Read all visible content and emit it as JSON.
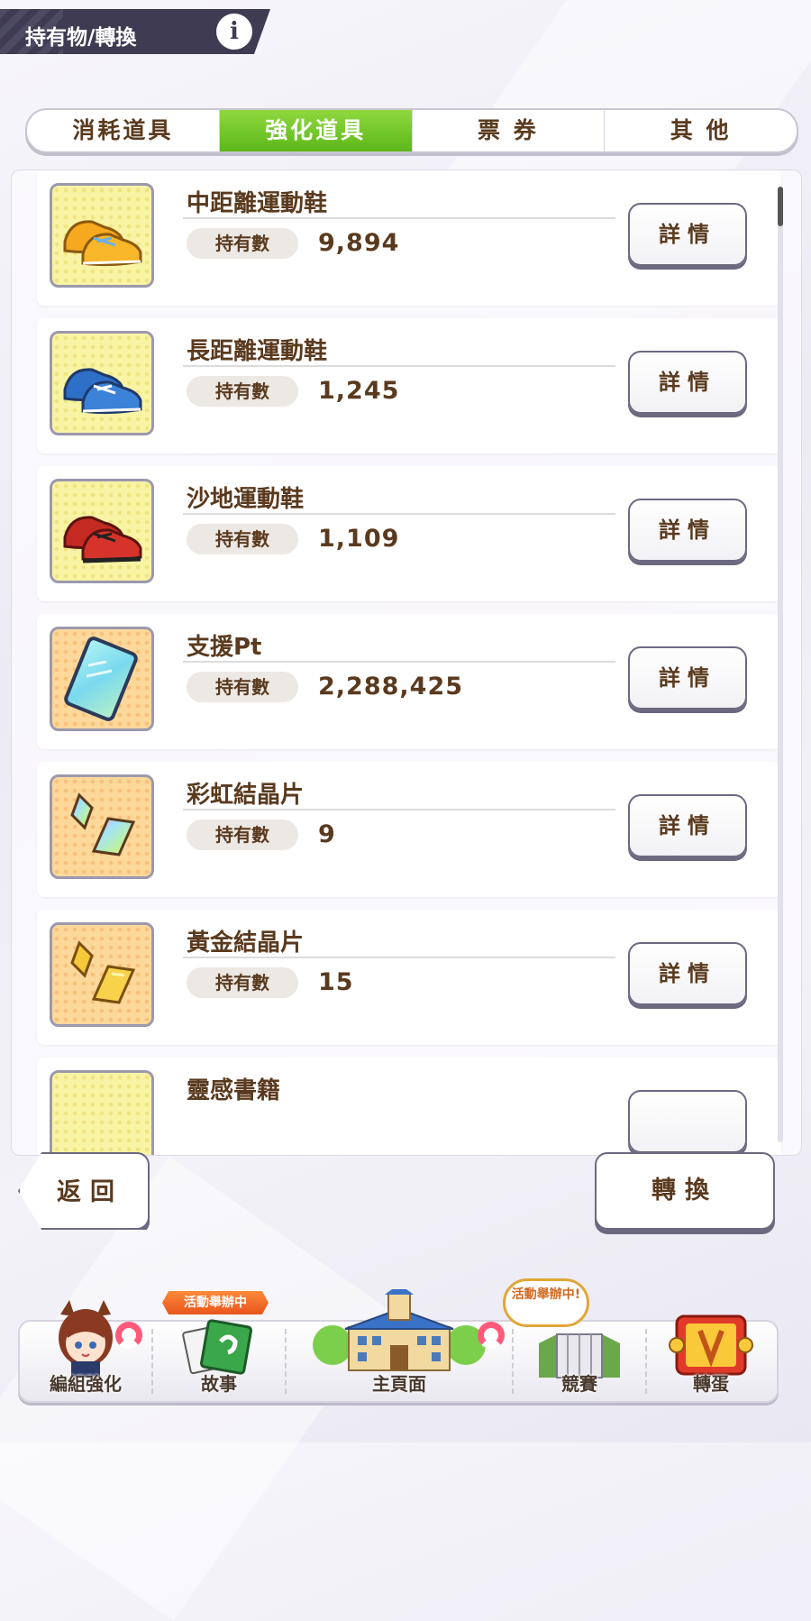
{
  "header": {
    "title": "持有物/轉換",
    "info_icon": "i"
  },
  "tabs": [
    {
      "label": "消耗道具",
      "active": false
    },
    {
      "label": "強化道具",
      "active": true
    },
    {
      "label": "票 券",
      "active": false
    },
    {
      "label": "其 他",
      "active": false
    }
  ],
  "items": [
    {
      "name": "中距離運動鞋",
      "qty_label": "持有數",
      "qty": "9,894",
      "icon": "yellow-shoes-icon",
      "detail_label": "詳情"
    },
    {
      "name": "長距離運動鞋",
      "qty_label": "持有數",
      "qty": "1,245",
      "icon": "blue-shoes-icon",
      "detail_label": "詳情"
    },
    {
      "name": "沙地運動鞋",
      "qty_label": "持有數",
      "qty": "1,109",
      "icon": "red-shoes-icon",
      "detail_label": "詳情"
    },
    {
      "name": "支援Pt",
      "qty_label": "持有數",
      "qty": "2,288,425",
      "icon": "support-card-icon",
      "detail_label": "詳情"
    },
    {
      "name": "彩虹結晶片",
      "qty_label": "持有數",
      "qty": "9",
      "icon": "rainbow-crystal-icon",
      "detail_label": "詳情"
    },
    {
      "name": "黃金結晶片",
      "qty_label": "持有數",
      "qty": "15",
      "icon": "gold-crystal-icon",
      "detail_label": "詳情"
    },
    {
      "name": "靈感書籍",
      "icon": "book-icon"
    }
  ],
  "buttons": {
    "back": "返回",
    "convert": "轉換"
  },
  "bottom_nav": [
    {
      "label": "編組強化",
      "icon": "character-icon"
    },
    {
      "label": "故事",
      "icon": "story-book-icon",
      "badge": "活動舉辦中"
    },
    {
      "label": "主頁面",
      "icon": "school-building-icon"
    },
    {
      "label": "競賽",
      "icon": "race-gate-icon",
      "badge": "活動舉辦中!"
    },
    {
      "label": "轉蛋",
      "icon": "gacha-icon"
    }
  ],
  "colors": {
    "active_tab": "#5cb81a",
    "text_brown": "#5a3a1e",
    "header_bg": "#3e3b52",
    "border": "#6c6880"
  }
}
